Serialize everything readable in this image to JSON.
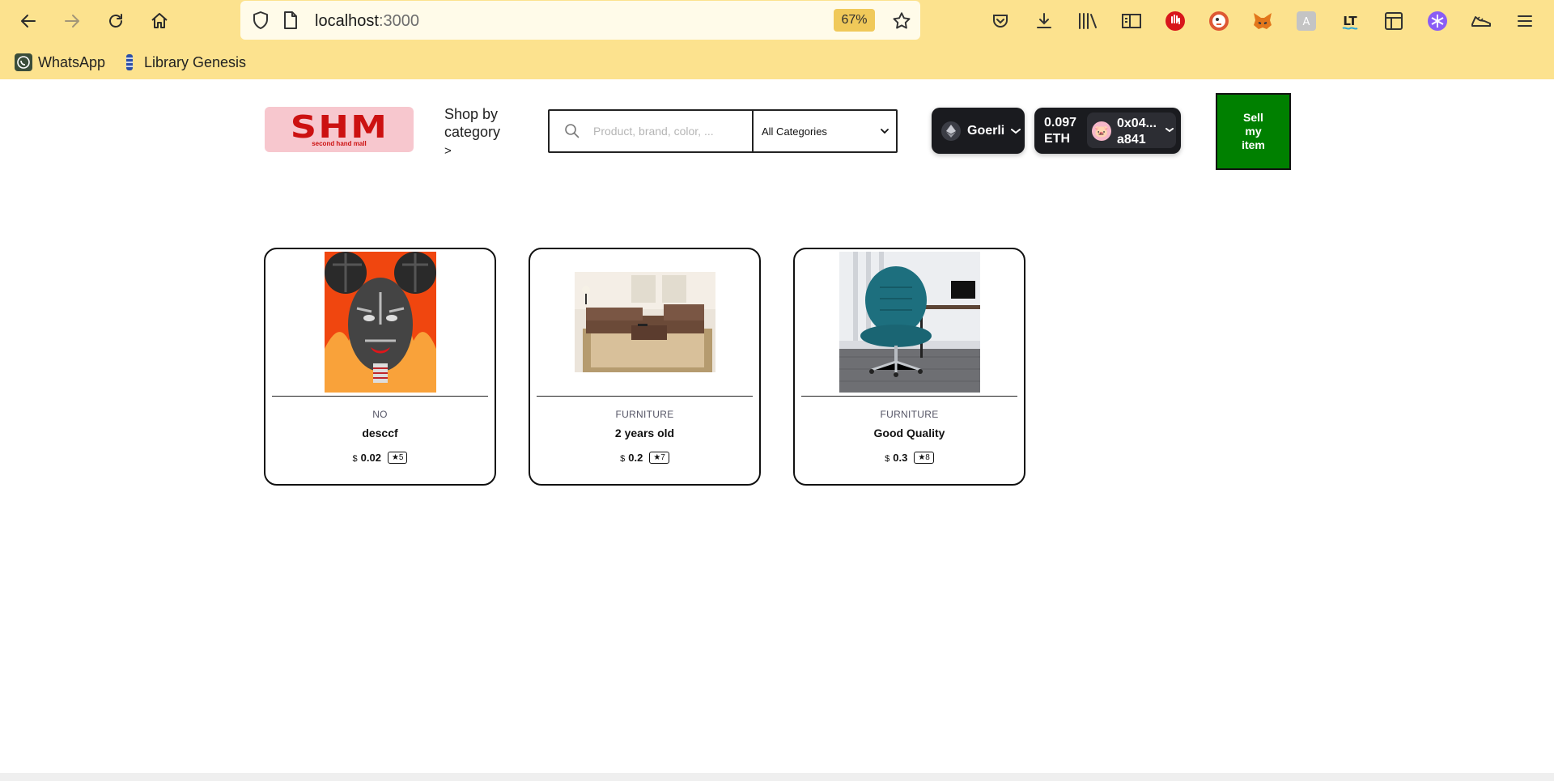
{
  "browser": {
    "url_host": "localhost",
    "url_port": ":3000",
    "zoom": "67%",
    "bookmarks": [
      {
        "label": "WhatsApp"
      },
      {
        "label": "Library Genesis"
      }
    ]
  },
  "header": {
    "logo_text": "SHM",
    "logo_sub": "second hand mall",
    "shop_by_category": "Shop by category",
    "shop_by_category_arrow": ">",
    "search_placeholder": "Product, brand, color, ...",
    "category_selected": "All Categories",
    "network": "Goerli",
    "balance_amount": "0.097",
    "balance_unit": "ETH",
    "account_line1": "0x04...",
    "account_line2": "a841",
    "sell_button": "Sell my item"
  },
  "products": [
    {
      "category": "NO",
      "title": "desccf",
      "currency": "$",
      "price": "0.02",
      "rating": "★5"
    },
    {
      "category": "FURNITURE",
      "title": "2 years old",
      "currency": "$",
      "price": "0.2",
      "rating": "★7"
    },
    {
      "category": "FURNITURE",
      "title": "Good Quality",
      "currency": "$",
      "price": "0.3",
      "rating": "★8"
    }
  ],
  "colors": {
    "chrome_bg": "#fce28e",
    "sell_button_bg": "#008000",
    "wallet_bg": "#1a1b1f",
    "logo_red": "#cc1111",
    "logo_bg": "#f7c7ce"
  }
}
